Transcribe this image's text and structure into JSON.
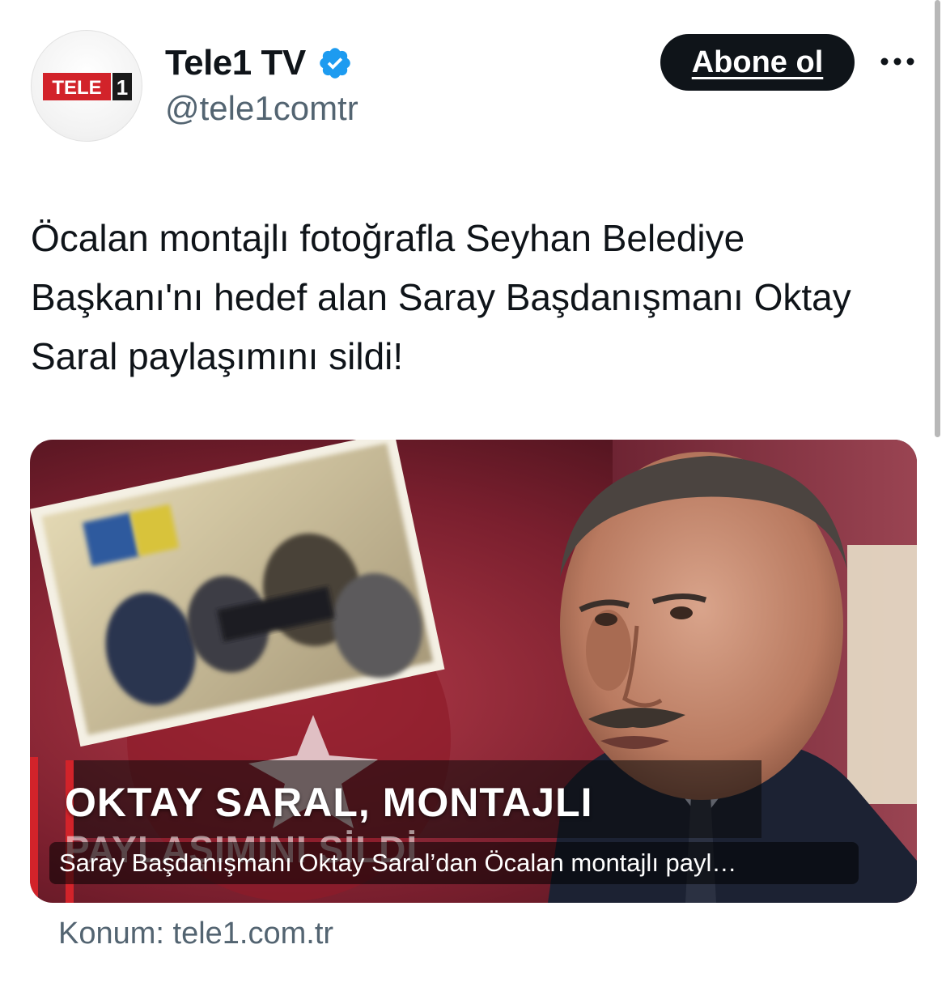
{
  "account": {
    "display_name": "Tele1 TV",
    "handle": "@tele1comtr",
    "verified": true,
    "avatar_logo_text": "TELE1",
    "verified_icon": "verified-badge-icon"
  },
  "actions": {
    "follow_label": "Abone ol",
    "more_icon": "more-horizontal-icon"
  },
  "tweet": {
    "text": "Öcalan montajlı fotoğrafla Seyhan Belediye Başkanı'nı hedef alan Saray Başdanışmanı Oktay Saral paylaşımını sildi!"
  },
  "card": {
    "headline_line1": "OKTAY SARAL, MONTAJLI",
    "headline_line2": "PAYLAŞIMINI SİLDİ",
    "caption": "Saray Başdanışmanı Oktay Saral’dan Öcalan montajlı payl…",
    "source": "Konum: tele1.com.tr"
  },
  "colors": {
    "text": "#0f1419",
    "muted": "#536471",
    "verified": "#1d9bf0",
    "brand_red": "#d2232a",
    "card_bg": "#7a1f2e"
  }
}
